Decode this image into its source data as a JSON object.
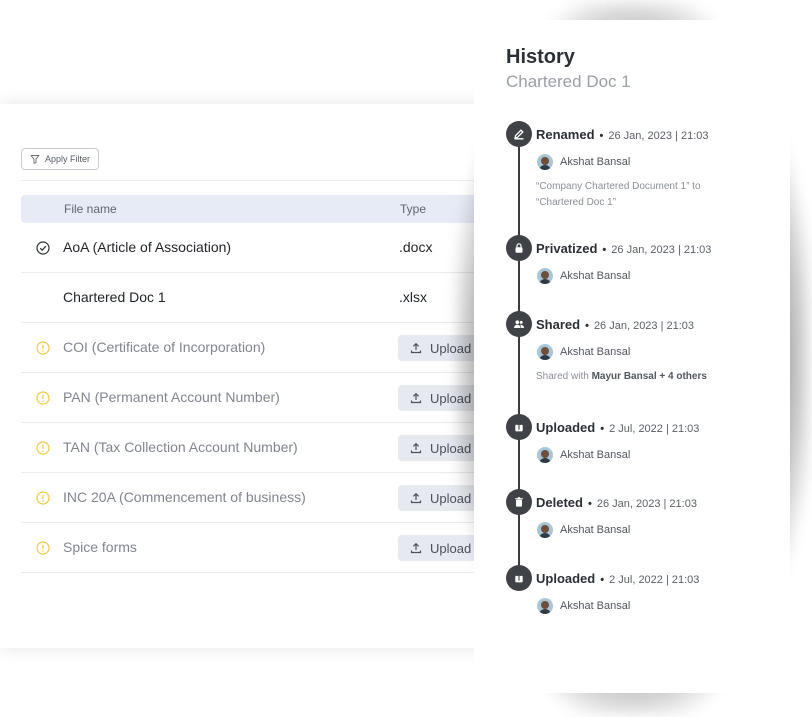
{
  "files_panel": {
    "filter_label": "Apply Filter",
    "columns": {
      "name": "File name",
      "type": "Type"
    },
    "rows": [
      {
        "name": "AoA (Article of Association)",
        "type": ".docx",
        "status": "check-circle-icon"
      },
      {
        "name": "Chartered Doc 1",
        "type": ".xlsx",
        "status": ""
      },
      {
        "name": "COI (Certificate of Incorporation)",
        "action": "Upload",
        "status": "warning-icon"
      },
      {
        "name": "PAN (Permanent Account Number)",
        "action": "Upload",
        "status": "warning-icon"
      },
      {
        "name": "TAN (Tax Collection Account Number)",
        "action": "Upload",
        "status": "warning-icon"
      },
      {
        "name": "INC 20A (Commencement of business)",
        "action": "Upload",
        "status": "warning-icon"
      },
      {
        "name": "Spice forms",
        "action": "Upload",
        "status": "warning-icon"
      }
    ]
  },
  "history": {
    "title": "History",
    "subtitle": "Chartered Doc 1",
    "events": [
      {
        "action": "Renamed",
        "date": "26 Jan, 2023 | 21:03",
        "user": "Akshat Bansal",
        "icon": "pencil-icon",
        "note": "“Company Chartered Document 1” to “Chartered Doc 1”"
      },
      {
        "action": "Privatized",
        "date": "26 Jan, 2023 | 21:03",
        "user": "Akshat Bansal",
        "icon": "lock-icon"
      },
      {
        "action": "Shared",
        "date": "26 Jan, 2023 | 21:03",
        "user": "Akshat Bansal",
        "icon": "people-icon",
        "note_prefix": "Shared with ",
        "note_bold": "Mayur Bansal + 4 others"
      },
      {
        "action": "Uploaded",
        "date": "2 Jul, 2022 | 21:03",
        "user": "Akshat Bansal",
        "icon": "upload-icon"
      },
      {
        "action": "Deleted",
        "date": "26 Jan, 2023 | 21:03",
        "user": "Akshat Bansal",
        "icon": "trash-icon"
      },
      {
        "action": "Uploaded",
        "date": "2 Jul, 2022 | 21:03",
        "user": "Akshat Bansal",
        "icon": "upload-icon"
      }
    ]
  },
  "colors": {
    "warning": "#f2c744",
    "timeline": "#3a3d42",
    "header_bg": "#e7ebf6"
  }
}
